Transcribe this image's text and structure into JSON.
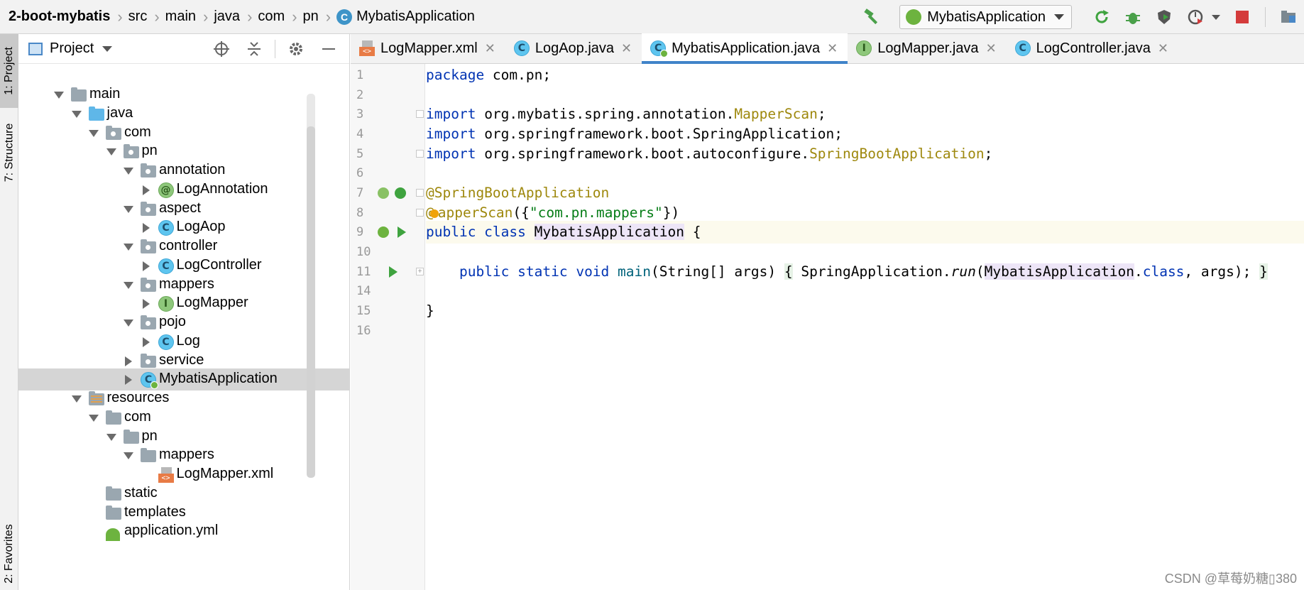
{
  "breadcrumbs": [
    "2-boot-mybatis",
    "src",
    "main",
    "java",
    "com",
    "pn",
    "MybatisApplication"
  ],
  "run_config": {
    "label": "MybatisApplication"
  },
  "left_strip": {
    "project_tab": "1: Project",
    "structure_tab": "7: Structure",
    "favorites_tab": "2: Favorites"
  },
  "project_panel": {
    "title": "Project"
  },
  "tree": [
    {
      "label": "main",
      "icon": "folder",
      "expanded": true
    },
    {
      "label": "java",
      "icon": "source-folder",
      "expanded": true
    },
    {
      "label": "com",
      "icon": "package",
      "expanded": true
    },
    {
      "label": "pn",
      "icon": "package",
      "expanded": true
    },
    {
      "label": "annotation",
      "icon": "package",
      "expanded": true
    },
    {
      "label": "LogAnnotation",
      "icon": "annotation-class",
      "expanded": false
    },
    {
      "label": "aspect",
      "icon": "package",
      "expanded": true
    },
    {
      "label": "LogAop",
      "icon": "class",
      "expanded": false
    },
    {
      "label": "controller",
      "icon": "package",
      "expanded": true
    },
    {
      "label": "LogController",
      "icon": "class",
      "expanded": false
    },
    {
      "label": "mappers",
      "icon": "package",
      "expanded": true
    },
    {
      "label": "LogMapper",
      "icon": "interface",
      "expanded": false
    },
    {
      "label": "pojo",
      "icon": "package",
      "expanded": true
    },
    {
      "label": "Log",
      "icon": "class",
      "expanded": false
    },
    {
      "label": "service",
      "icon": "package",
      "expanded": false
    },
    {
      "label": "MybatisApplication",
      "icon": "spring-boot-class",
      "expanded": false,
      "selected": true
    },
    {
      "label": "resources",
      "icon": "resources-folder",
      "expanded": true
    },
    {
      "label": "com",
      "icon": "folder",
      "expanded": true
    },
    {
      "label": "pn",
      "icon": "folder",
      "expanded": true
    },
    {
      "label": "mappers",
      "icon": "folder",
      "expanded": true
    },
    {
      "label": "LogMapper.xml",
      "icon": "xml-file"
    },
    {
      "label": "static",
      "icon": "folder"
    },
    {
      "label": "templates",
      "icon": "folder"
    },
    {
      "label": "application.yml",
      "icon": "yml-file"
    }
  ],
  "tabs": [
    {
      "label": "LogMapper.xml",
      "icon": "xml-file",
      "active": false
    },
    {
      "label": "LogAop.java",
      "icon": "class",
      "active": false
    },
    {
      "label": "MybatisApplication.java",
      "icon": "spring-boot-class",
      "active": true
    },
    {
      "label": "LogMapper.java",
      "icon": "interface",
      "active": false
    },
    {
      "label": "LogController.java",
      "icon": "class",
      "active": false
    }
  ],
  "line_numbers": [
    "1",
    "2",
    "3",
    "4",
    "5",
    "6",
    "7",
    "8",
    "9",
    "10",
    "11",
    "14",
    "15",
    "16"
  ],
  "code": {
    "l1_kw": "package",
    "l1_rest": " com.pn;",
    "l3_kw": "import",
    "l3_pkg": " org.mybatis.spring.annotation.",
    "l3_cls": "MapperScan",
    "l3_end": ";",
    "l4_kw": "import",
    "l4_rest": " org.springframework.boot.SpringApplication;",
    "l5_kw": "import",
    "l5_pkg": " org.springframework.boot.autoconfigure.",
    "l5_cls": "SpringBootApplication",
    "l5_end": ";",
    "l7": "@SpringBootApplication",
    "l8_ann1": "@",
    "l8_ann2": "apperScan",
    "l8_p1": "({",
    "l8_str": "\"com.pn.mappers\"",
    "l8_p2": "})",
    "l9_kw": "public class ",
    "l9_cls": "MybatisApplication",
    "l9_end": " {",
    "l11_indent": "    ",
    "l11_kw": "public static void ",
    "l11_m": "main",
    "l11_args": "(String[] args) ",
    "l11_ob": "{",
    "l11_sp": " SpringApplication.",
    "l11_run": "run",
    "l11_p": "(",
    "l11_cls": "MybatisApplication",
    "l11_dot": ".",
    "l11_class": "class",
    "l11_rest": ", args); ",
    "l11_cb": "}",
    "l15": "}"
  },
  "watermark": "CSDN @草莓奶糖▯380",
  "colors": {
    "keyword": "#0033b3",
    "annotation": "#9e880d",
    "string": "#067d17",
    "accent": "#4083c9"
  }
}
